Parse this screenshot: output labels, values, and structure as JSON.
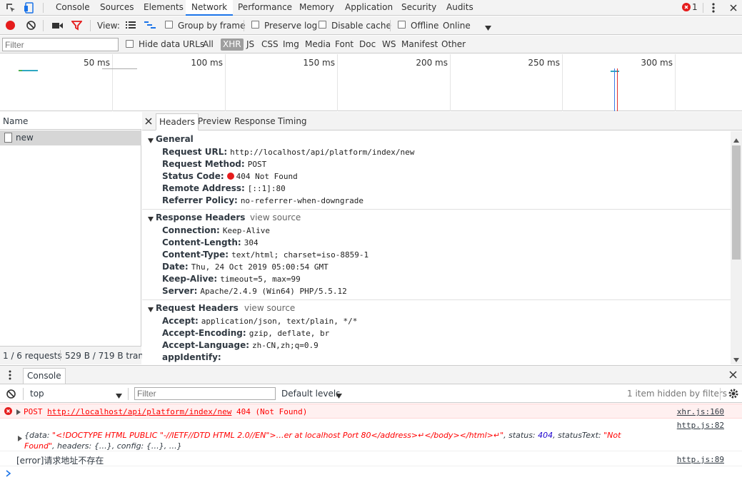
{
  "tabs": [
    "Console",
    "Sources",
    "Elements",
    "Network",
    "Performance",
    "Memory",
    "Application",
    "Security",
    "Audits"
  ],
  "active_tab": "Network",
  "error_count": "1",
  "toolbar": {
    "view_label": "View:",
    "group_by_frame": "Group by frame",
    "preserve_log": "Preserve log",
    "disable_cache": "Disable cache",
    "offline": "Offline",
    "throttle": "Online"
  },
  "filter": {
    "placeholder": "Filter",
    "hide_data_urls": "Hide data URLs",
    "types": [
      "All",
      "XHR",
      "JS",
      "CSS",
      "Img",
      "Media",
      "Font",
      "Doc",
      "WS",
      "Manifest",
      "Other"
    ],
    "active_type": "XHR"
  },
  "overview": {
    "ticks": [
      "50 ms",
      "100 ms",
      "150 ms",
      "200 ms",
      "250 ms",
      "300 ms"
    ]
  },
  "name_panel": {
    "header": "Name",
    "rows": [
      "new"
    ],
    "status_requests": "1 / 6 requests",
    "status_transferred": "529 B / 719 B tran..."
  },
  "details": {
    "tabs": [
      "Headers",
      "Preview",
      "Response",
      "Timing"
    ],
    "active_tab": "Headers",
    "general": {
      "title": "General",
      "rows": [
        {
          "key": "Request URL:",
          "value": "http://localhost/api/platform/index/new"
        },
        {
          "key": "Request Method:",
          "value": "POST"
        },
        {
          "key": "Status Code:",
          "value": "404 Not Found"
        },
        {
          "key": "Remote Address:",
          "value": "[::1]:80"
        },
        {
          "key": "Referrer Policy:",
          "value": "no-referrer-when-downgrade"
        }
      ]
    },
    "response_headers": {
      "title": "Response Headers",
      "view_source": "view source",
      "rows": [
        {
          "key": "Connection:",
          "value": "Keep-Alive"
        },
        {
          "key": "Content-Length:",
          "value": "304"
        },
        {
          "key": "Content-Type:",
          "value": "text/html; charset=iso-8859-1"
        },
        {
          "key": "Date:",
          "value": "Thu, 24 Oct 2019 05:00:54 GMT"
        },
        {
          "key": "Keep-Alive:",
          "value": "timeout=5, max=99"
        },
        {
          "key": "Server:",
          "value": "Apache/2.4.9 (Win64) PHP/5.5.12"
        }
      ]
    },
    "request_headers": {
      "title": "Request Headers",
      "view_source": "view source",
      "rows": [
        {
          "key": "Accept:",
          "value": "application/json, text/plain, */*"
        },
        {
          "key": "Accept-Encoding:",
          "value": "gzip, deflate, br"
        },
        {
          "key": "Accept-Language:",
          "value": "zh-CN,zh;q=0.9"
        },
        {
          "key": "appIdentify:",
          "value": ""
        }
      ]
    }
  },
  "console": {
    "tab": "Console",
    "context": "top",
    "filter_placeholder": "Filter",
    "levels": "Default levels",
    "hidden": "1 item hidden by filters",
    "messages": {
      "error_method": "POST",
      "error_url": "http://localhost/api/platform/index/new",
      "error_status": "404 (Not Found)",
      "error_src": "xhr.js:160",
      "obj_src": "http.js:82",
      "obj_line1_a": "{data: ",
      "obj_line1_str": "\"<!DOCTYPE HTML PUBLIC \"-//IETF//DTD HTML 2.0//EN\">…er at localhost Port 80</address>↵</body></html>↵\"",
      "obj_line1_b": ", status: ",
      "obj_status": "404",
      "obj_line1_c": ", statusText: ",
      "obj_statustext_a": "\"Not",
      "obj_statustext_b": "Found\"",
      "obj_line2": ", headers: {…}, config: {…}, …}",
      "log_text": "[error]请求地址不存在",
      "log_src": "http.js:89"
    }
  },
  "colors": {
    "accent": "#1a73e8",
    "record_red": "#e51c1c",
    "error_red": "#ff0000"
  }
}
